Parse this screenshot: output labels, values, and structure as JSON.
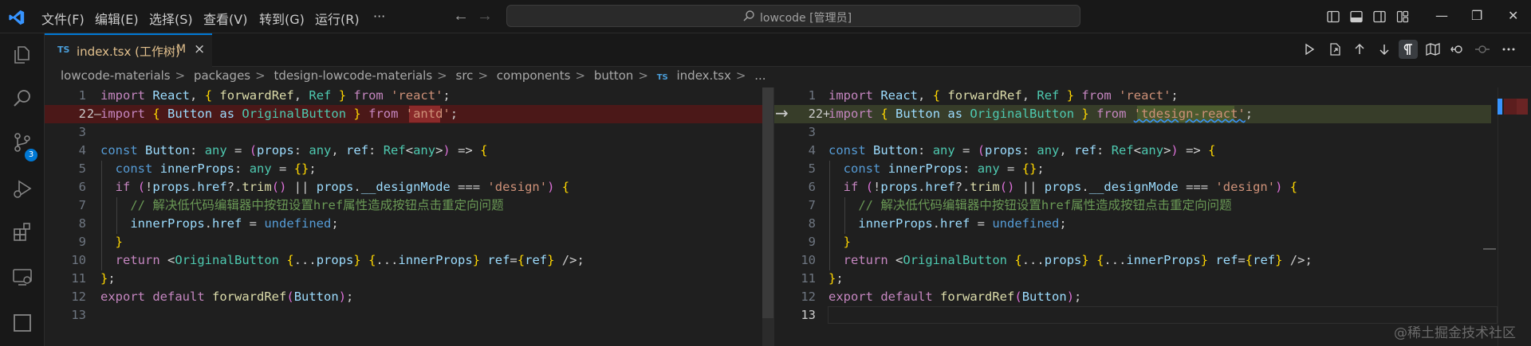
{
  "menu": [
    "文件(F)",
    "编辑(E)",
    "选择(S)",
    "查看(V)",
    "转到(G)",
    "运行(R)",
    "···"
  ],
  "search": {
    "text": "lowcode [管理员]"
  },
  "activity": {
    "scm_badge": "3"
  },
  "tab": {
    "type": "TS",
    "label": "index.tsx (工作树)",
    "status": "M",
    "close": "×"
  },
  "breadcrumb": {
    "items": [
      "lowcode-materials",
      "packages",
      "tdesign-lowcode-materials",
      "src",
      "components",
      "button"
    ],
    "file_type": "TS",
    "file": "index.tsx",
    "tail": "...",
    "sep": ">"
  },
  "diff": {
    "arrow": "→",
    "left_marker": "2—",
    "right_marker": "2+"
  },
  "left_code": {
    "line_numbers": [
      "1",
      "2",
      "3",
      "4",
      "5",
      "6",
      "7",
      "8",
      "9",
      "10",
      "11",
      "12",
      "13"
    ],
    "lines": [
      "import React, { forwardRef, Ref } from 'react';",
      "import { Button as OriginalButton } from 'antd';",
      "",
      "const Button: any = (props: any, ref: Ref<any>) => {",
      "  const innerProps: any = {};",
      "  if (!props.href?.trim() || props.__designMode === 'design') {",
      "    // 解决低代码编辑器中按钮设置href属性造成按钮点击重定向问题",
      "    innerProps.href = undefined;",
      "  }",
      "  return <OriginalButton {...props} {...innerProps} ref={ref} />;",
      "};",
      "export default forwardRef(Button);",
      ""
    ]
  },
  "right_code": {
    "line_numbers": [
      "1",
      "2",
      "3",
      "4",
      "5",
      "6",
      "7",
      "8",
      "9",
      "10",
      "11",
      "12",
      "13"
    ],
    "lines": [
      "import React, { forwardRef, Ref } from 'react';",
      "import { Button as OriginalButton } from 'tdesign-react';",
      "",
      "const Button: any = (props: any, ref: Ref<any>) => {",
      "  const innerProps: any = {};",
      "  if (!props.href?.trim() || props.__designMode === 'design') {",
      "    // 解决低代码编辑器中按钮设置href属性造成按钮点击重定向问题",
      "    innerProps.href = undefined;",
      "  }",
      "  return <OriginalButton {...props} {...innerProps} ref={ref} />;",
      "};",
      "export default forwardRef(Button);",
      ""
    ]
  },
  "watermark": "@稀土掘金技术社区",
  "colors": {
    "accent": "#0078d4",
    "deleted": "#4b1818",
    "inserted": "#373d29"
  }
}
